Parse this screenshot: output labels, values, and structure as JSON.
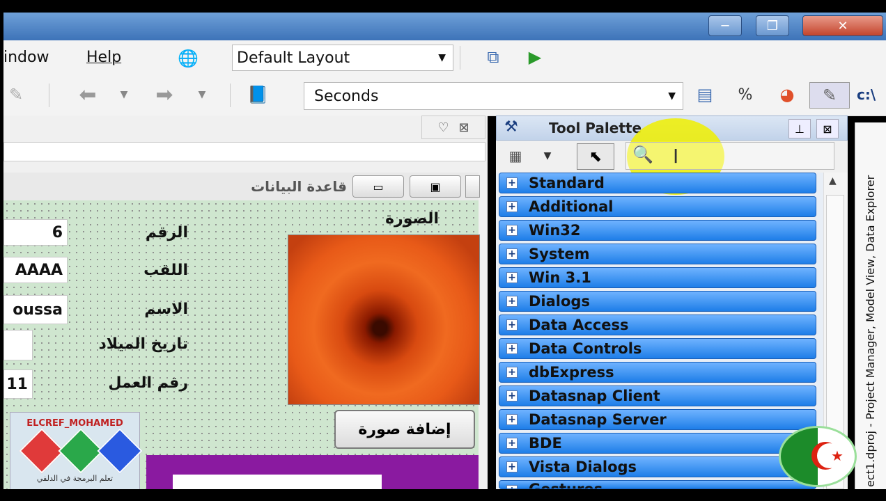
{
  "menu": {
    "window_label": "indow",
    "help_label": "Help"
  },
  "toolbar": {
    "layout_combo_value": "Default Layout",
    "units_combo_value": "Seconds",
    "path_text": "c:\\"
  },
  "form": {
    "caption": "قاعدة البيانات",
    "image_label": "الصورة",
    "fields": [
      {
        "label": "الرقم",
        "value": "6"
      },
      {
        "label": "اللقب",
        "value": "AAAA"
      },
      {
        "label": "الاسم",
        "value": "oussa"
      },
      {
        "label": "تاريخ الميلاد",
        "value": ""
      },
      {
        "label": "رقم العمل",
        "value": "11"
      }
    ],
    "add_image_button": "إضافة صورة"
  },
  "logo": {
    "name": "ELCREF_MOHAMED",
    "subtitle": "تعلم البرمجة في الدلفي"
  },
  "palette": {
    "title": "Tool Palette",
    "categories": [
      "Standard",
      "Additional",
      "Win32",
      "System",
      "Win 3.1",
      "Dialogs",
      "Data Access",
      "Data Controls",
      "dbExpress",
      "Datasnap Client",
      "Datasnap Server",
      "BDE",
      "Vista Dialogs",
      "Gestures"
    ]
  },
  "side_panel": {
    "tab_text": "ect1.dproj - Project Manager, Model View, Data Explorer"
  },
  "colors": {
    "category_blue": "#1e7ee8",
    "form_bg": "#cfe6cf",
    "title_bar": "#3d73b8"
  }
}
